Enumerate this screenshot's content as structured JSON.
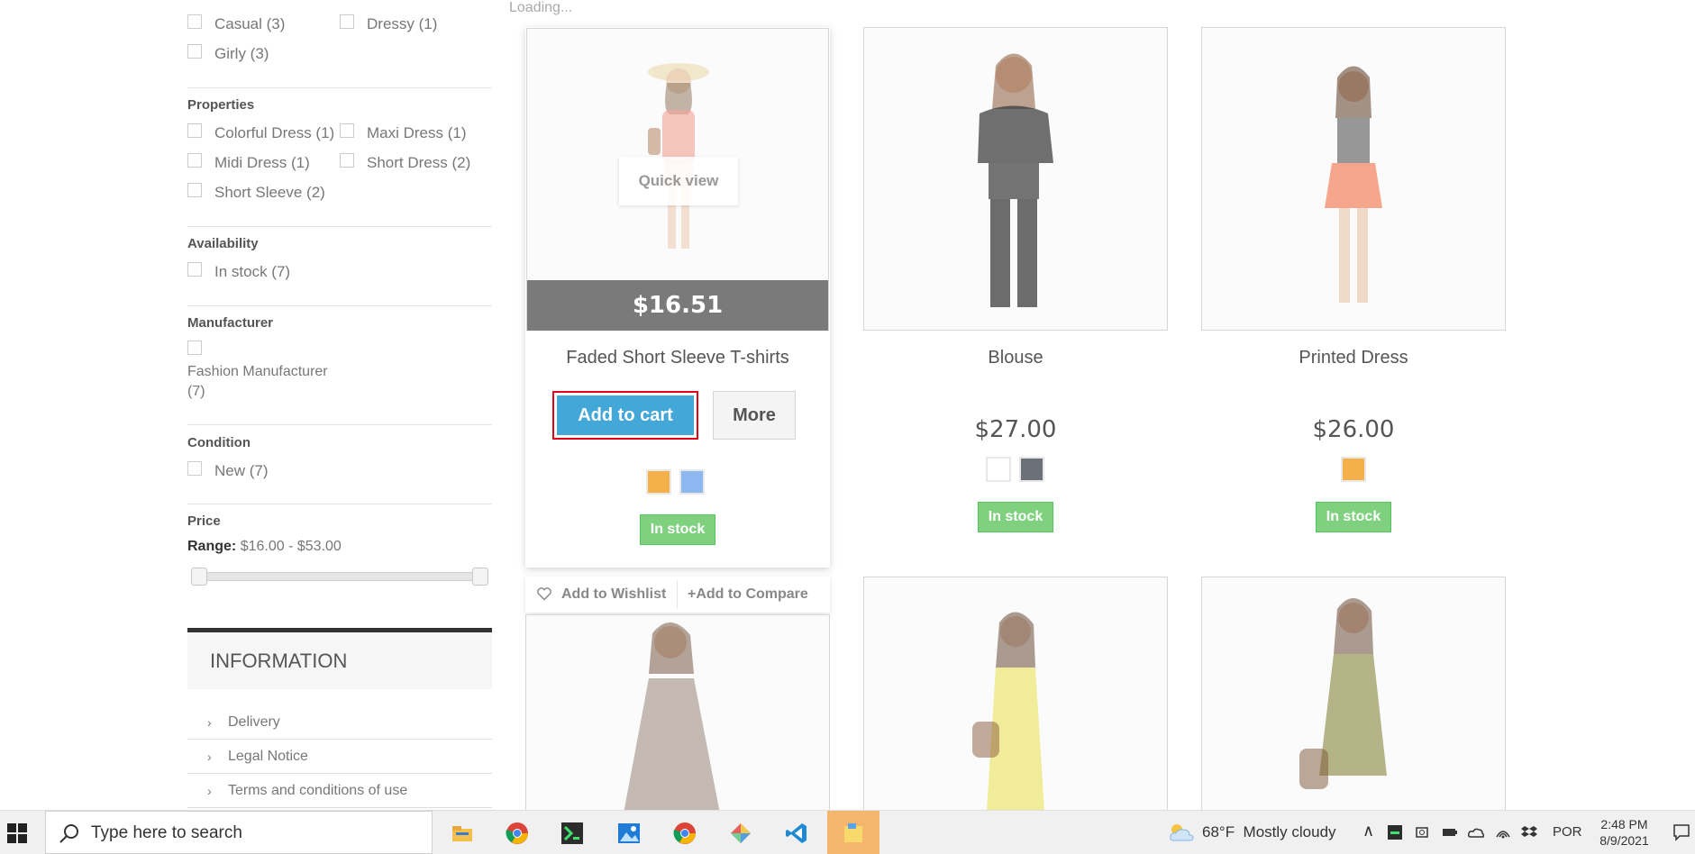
{
  "sidebar": {
    "styles": [
      {
        "label": "Casual (3)"
      },
      {
        "label": "Dressy (1)"
      },
      {
        "label": "Girly (3)"
      }
    ],
    "properties_title": "Properties",
    "properties": [
      {
        "label": "Colorful Dress (1)"
      },
      {
        "label": "Maxi Dress (1)"
      },
      {
        "label": "Midi Dress (1)"
      },
      {
        "label": "Short Dress (2)"
      },
      {
        "label": "Short Sleeve (2)"
      }
    ],
    "availability_title": "Availability",
    "availability": [
      {
        "label": "In stock (7)"
      }
    ],
    "manufacturer_title": "Manufacturer",
    "manufacturer": [
      {
        "label": "Fashion Manufacturer",
        "count": "(7)"
      }
    ],
    "condition_title": "Condition",
    "condition": [
      {
        "label": "New (7)"
      }
    ],
    "price_title": "Price",
    "range_label": "Range:",
    "range_value": "$16.00 - $53.00",
    "information_title": "INFORMATION",
    "information_links": [
      {
        "label": "Delivery"
      },
      {
        "label": "Legal Notice"
      },
      {
        "label": "Terms and conditions of use"
      }
    ]
  },
  "products": {
    "loading": "Loading...",
    "items": [
      {
        "name": "Faded Short Sleeve T-shirts",
        "price": "$16.51",
        "quick_view": "Quick view",
        "add_to_cart": "Add to cart",
        "more": "More",
        "stock": "In stock",
        "colors": [
          "#f5b04a",
          "#8cb8ef"
        ],
        "wishlist": "Add to Wishlist",
        "compare": "Add to Compare"
      },
      {
        "name": "Blouse",
        "price": "$27.00",
        "stock": "In stock",
        "colors": [
          "#ffffff",
          "#6c7079"
        ]
      },
      {
        "name": "Printed Dress",
        "price": "$26.00",
        "stock": "In stock",
        "colors": [
          "#f5b04a"
        ]
      }
    ]
  },
  "taskbar": {
    "search_placeholder": "Type here to search",
    "weather": "68°F  Mostly cloudy",
    "language": "POR",
    "time": "2:48 PM",
    "date": "8/9/2021"
  }
}
